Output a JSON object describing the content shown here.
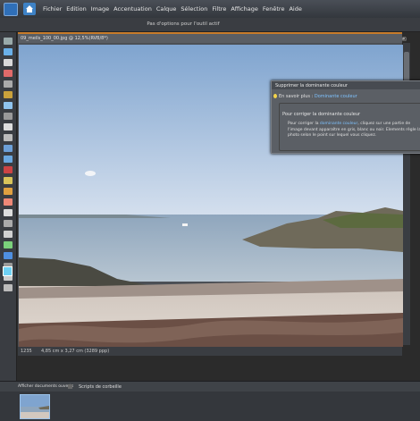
{
  "menu": {
    "items": [
      "Fichier",
      "Edition",
      "Image",
      "Accentuation",
      "Calque",
      "Sélection",
      "Filtre",
      "Affichage",
      "Fenêtre",
      "Aide"
    ]
  },
  "options_bar": {
    "message": "Pas d'options pour l'outil actif"
  },
  "document": {
    "title": "09_meils_100_00.jpg @ 12,5%(RVB/8*)",
    "zoom": "1235",
    "dimensions": "4,85 cm x 3,27 cm (3289 ppp)"
  },
  "dialog": {
    "title": "Supprimer la dominante couleur",
    "more_prefix": "En savoir plus :",
    "more_link": "Dominante couleur",
    "heading": "Pour corriger la dominante couleur",
    "instr_1": "Pour corriger la",
    "instr_link": "dominante couleur",
    "instr_2": ", cliquez sur une partie de l'image devant apparaître en gris, blanc ou noir. Elements règle la photo selon le point sur lequel vous cliquez."
  },
  "project_bin": {
    "show_open_label": "Afficher documents ouverts",
    "scripts_label": "Scripts de corbeille"
  },
  "colors": {
    "accent": "#c77b2a",
    "link": "#7fc3ff"
  }
}
